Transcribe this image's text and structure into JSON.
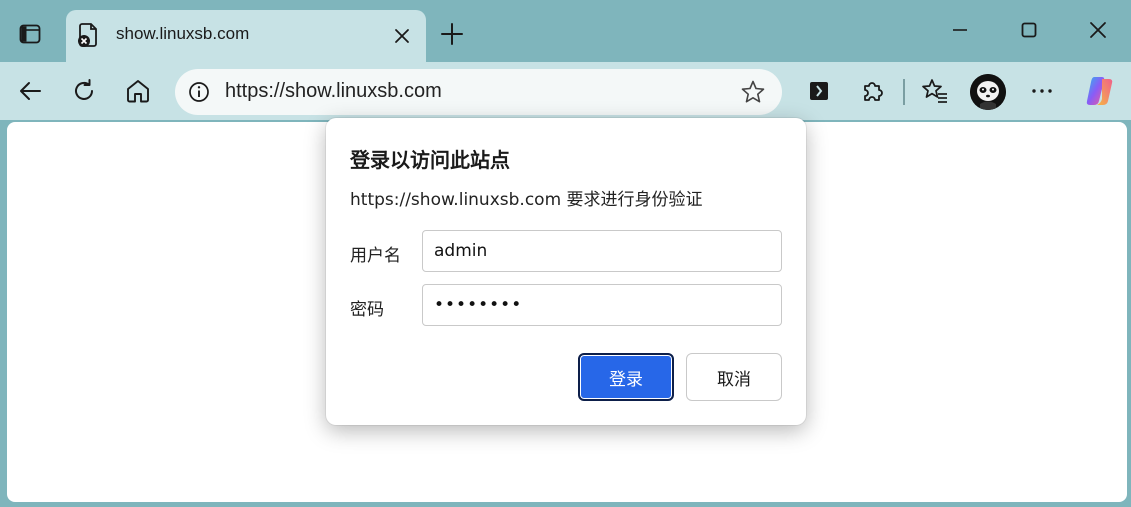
{
  "tab": {
    "title": "show.linuxsb.com"
  },
  "address_bar": {
    "url": "https://show.linuxsb.com"
  },
  "icons": {
    "tab_actions": "tab-actions-icon",
    "favicon": "document-error-icon",
    "tab_close": "close-icon",
    "new_tab": "plus-icon",
    "minimize": "minimize-icon",
    "maximize": "maximize-icon",
    "window_close": "close-icon",
    "back": "back-arrow-icon",
    "refresh": "refresh-icon",
    "home": "home-icon",
    "site_info": "info-icon",
    "favorite": "star-icon",
    "reading": "reading-icon",
    "extensions": "puzzle-icon",
    "favorites_list": "favorites-icon",
    "profile": "avatar",
    "more": "more-icon",
    "copilot": "copilot-icon"
  },
  "dialog": {
    "title": "登录以访问此站点",
    "description": "https://show.linuxsb.com 要求进行身份验证",
    "username_label": "用户名",
    "username_value": "admin",
    "password_label": "密码",
    "password_value": "••••••••",
    "login_button": "登录",
    "cancel_button": "取消"
  },
  "colors": {
    "frame": "#7fb5bc",
    "toolbar": "#c7e2e5",
    "primary_button": "#2767e8"
  }
}
